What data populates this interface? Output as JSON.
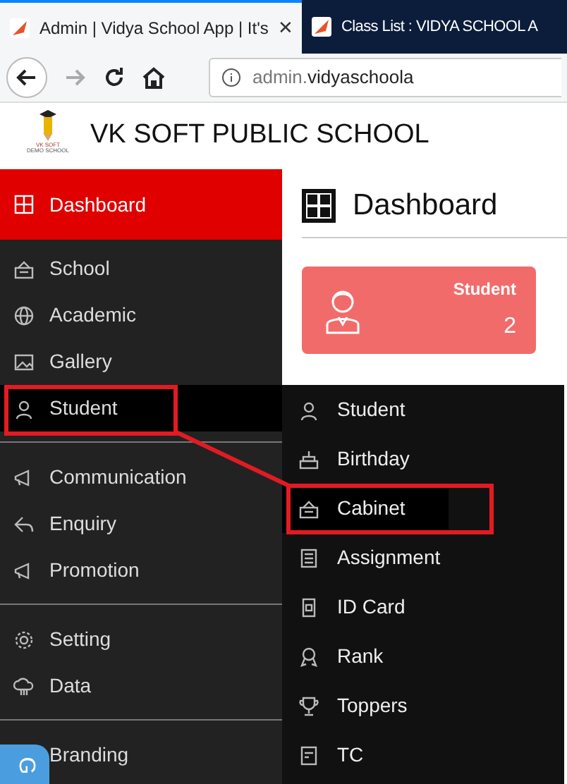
{
  "browser": {
    "tabs": [
      {
        "title": "Admin | Vidya School App | It's",
        "selected": true,
        "close": "✕"
      },
      {
        "title": "Class List : VIDYA SCHOOL A",
        "selected": false
      }
    ],
    "url": {
      "subdomain": "admin.",
      "domain": "vidyaschoola"
    }
  },
  "header": {
    "logo_line1": "VK SOFT",
    "logo_line2": "DEMO SCHOOL",
    "title": "VK SOFT PUBLIC SCHOOL"
  },
  "sidebar": {
    "groups": [
      [
        {
          "label": "Dashboard",
          "selected": true,
          "hovered": false
        }
      ],
      [
        {
          "label": "School",
          "selected": false,
          "hovered": false
        },
        {
          "label": "Academic",
          "selected": false,
          "hovered": false
        },
        {
          "label": "Gallery",
          "selected": false,
          "hovered": false
        },
        {
          "label": "Student",
          "selected": false,
          "hovered": true
        }
      ],
      [
        {
          "label": "Communication",
          "selected": false,
          "hovered": false
        },
        {
          "label": "Enquiry",
          "selected": false,
          "hovered": false
        },
        {
          "label": "Promotion",
          "selected": false,
          "hovered": false
        }
      ],
      [
        {
          "label": "Setting",
          "selected": false,
          "hovered": false
        },
        {
          "label": "Data",
          "selected": false,
          "hovered": false
        }
      ],
      [
        {
          "label": "Branding",
          "selected": false,
          "hovered": false
        }
      ]
    ]
  },
  "submenu": [
    {
      "label": "Student",
      "hovered": false
    },
    {
      "label": "Birthday",
      "hovered": false
    },
    {
      "label": "Cabinet",
      "hovered": true
    },
    {
      "label": "Assignment",
      "hovered": false
    },
    {
      "label": "ID Card",
      "hovered": false
    },
    {
      "label": "Rank",
      "hovered": false
    },
    {
      "label": "Toppers",
      "hovered": false
    },
    {
      "label": "TC",
      "hovered": false
    }
  ],
  "main": {
    "title": "Dashboard",
    "cards": [
      {
        "label": "Student",
        "count": "2",
        "color": "#f26b6b"
      }
    ]
  },
  "floating_button": {
    "label": "G"
  }
}
